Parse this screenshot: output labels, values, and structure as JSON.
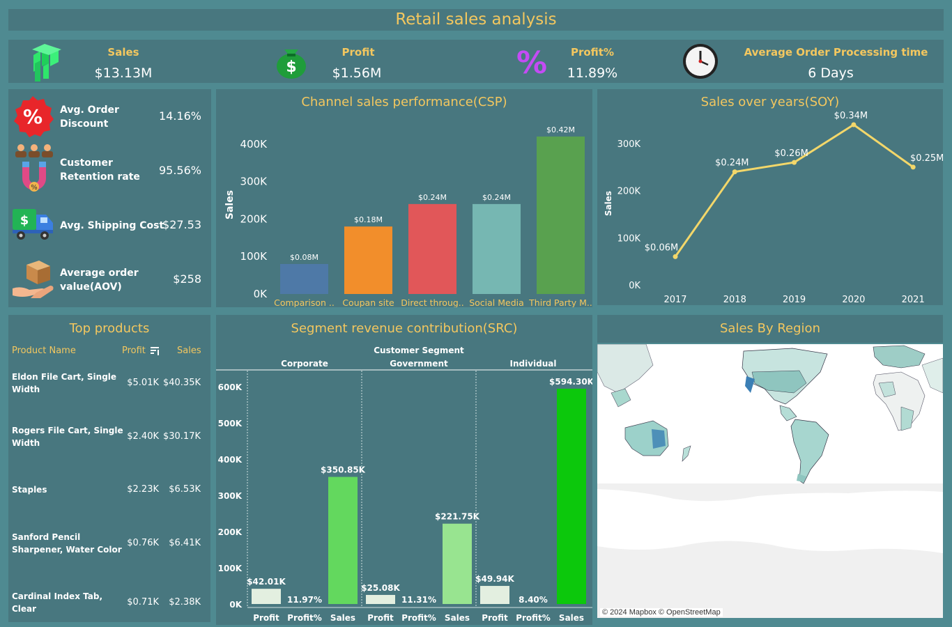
{
  "title": "Retail sales analysis",
  "kpis": {
    "sales": {
      "label": "Sales",
      "value": "$13.13M"
    },
    "profit": {
      "label": "Profit",
      "value": "$1.56M"
    },
    "profit_pct": {
      "label": "Profit%",
      "value": "11.89%"
    },
    "processing": {
      "label": "Average  Order Processing time",
      "value": "6 Days"
    }
  },
  "side_kpis": [
    {
      "label": "Avg. Order Discount",
      "value": "14.16%",
      "icon": "discount-badge-icon"
    },
    {
      "label": "Customer Retention rate",
      "value": "95.56%",
      "icon": "customer-magnet-icon"
    },
    {
      "label": "Avg. Shipping Cost",
      "value": "$27.53",
      "icon": "delivery-truck-icon"
    },
    {
      "label": "Average order value(AOV)",
      "value": "$258",
      "icon": "package-hand-icon"
    }
  ],
  "csp": {
    "title": "Channel sales performance(CSP)",
    "chart_data": {
      "type": "bar",
      "ylabel": "Sales",
      "categories": [
        "Comparison ..",
        "Coupan site",
        "Direct throug..",
        "Social Media",
        "Third Party M.."
      ],
      "values": [
        80000,
        180000,
        240000,
        240000,
        420000
      ],
      "data_labels": [
        "$0.08M",
        "$0.18M",
        "$0.24M",
        "$0.24M",
        "$0.42M"
      ],
      "colors": [
        "#4e79a7",
        "#f28e2b",
        "#e15759",
        "#76b7b2",
        "#59a14f"
      ],
      "yticks": [
        "0K",
        "100K",
        "200K",
        "300K",
        "400K"
      ],
      "ylim": [
        0,
        420000
      ]
    }
  },
  "soy": {
    "title": "Sales over years(SOY)",
    "chart_data": {
      "type": "line",
      "ylabel": "Sales",
      "x": [
        "2017",
        "2018",
        "2019",
        "2020",
        "2021"
      ],
      "values": [
        60000,
        240000,
        260000,
        340000,
        250000
      ],
      "data_labels": [
        "$0.06M",
        "$0.24M",
        "$0.26M",
        "$0.34M",
        "$0.25M"
      ],
      "yticks": [
        "0K",
        "100K",
        "200K",
        "300K"
      ],
      "ylim": [
        0,
        340000
      ],
      "color": "#f3d76a"
    }
  },
  "top_products": {
    "title": "Top products",
    "headers": {
      "name": "Product Name",
      "profit": "Profit",
      "sales": "Sales"
    },
    "rows": [
      {
        "name": "Eldon File Cart, Single Width",
        "profit": "$5.01K",
        "sales": "$40.35K"
      },
      {
        "name": "Rogers File Cart, Single Width",
        "profit": "$2.40K",
        "sales": "$30.17K"
      },
      {
        "name": "Staples",
        "profit": "$2.23K",
        "sales": "$6.53K"
      },
      {
        "name": "Sanford Pencil Sharpener, Water Color",
        "profit": "$0.76K",
        "sales": "$6.41K"
      },
      {
        "name": "Cardinal Index Tab, Clear",
        "profit": "$0.71K",
        "sales": "$2.38K"
      }
    ]
  },
  "src": {
    "title": "Segment revenue contribution(SRC)",
    "chart_data": {
      "type": "bar",
      "header": "Customer Segment",
      "segments": [
        {
          "name": "Corporate",
          "bars": [
            {
              "label": "Profit",
              "value": 42010,
              "text": "$42.01K"
            },
            {
              "label": "Profit%",
              "value": 0,
              "text": "11.97%"
            },
            {
              "label": "Sales",
              "value": 350850,
              "text": "$350.85K"
            }
          ]
        },
        {
          "name": "Government",
          "bars": [
            {
              "label": "Profit",
              "value": 25080,
              "text": "$25.08K"
            },
            {
              "label": "Profit%",
              "value": 0,
              "text": "11.31%"
            },
            {
              "label": "Sales",
              "value": 221750,
              "text": "$221.75K"
            }
          ]
        },
        {
          "name": "Individual",
          "bars": [
            {
              "label": "Profit",
              "value": 49940,
              "text": "$49.94K"
            },
            {
              "label": "Profit%",
              "value": 0,
              "text": "8.40%"
            },
            {
              "label": "Sales",
              "value": 594300,
              "text": "$594.30K"
            }
          ]
        }
      ],
      "yticks": [
        "0K",
        "100K",
        "200K",
        "300K",
        "400K",
        "500K",
        "600K"
      ],
      "ylim": [
        0,
        600000
      ],
      "colors": {
        "profit": "#e3efe0",
        "sales": [
          "#63d85e",
          "#98e490",
          "#0cc80c"
        ]
      }
    }
  },
  "map": {
    "title": "Sales By Region",
    "credit": "© 2024 Mapbox © OpenStreetMap"
  }
}
